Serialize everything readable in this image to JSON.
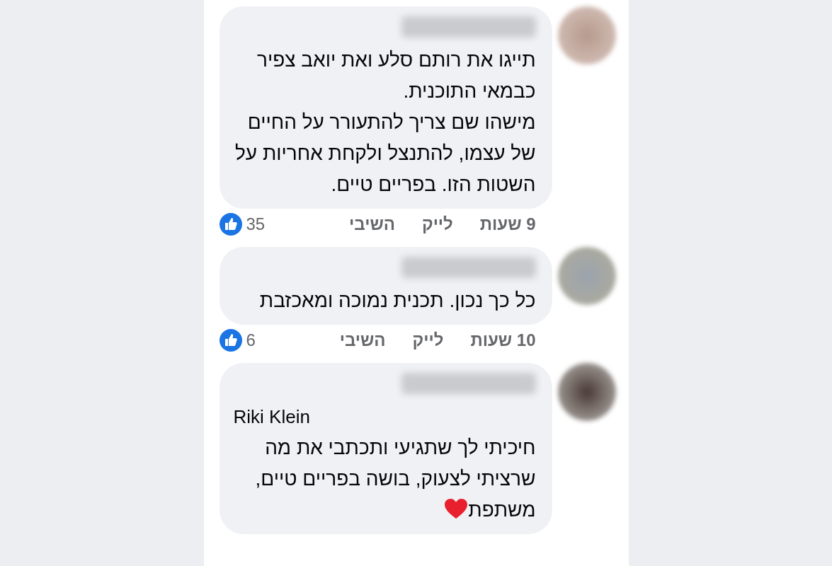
{
  "comments": [
    {
      "paragraphs": [
        "תייגו את רותם סלע ואת יואב צפיר כבמאי התוכנית.",
        "מישהו שם צריך להתעורר על החיים של עצמו, להתנצל ולקחת אחריות על השטות הזו. בפריים טיים."
      ],
      "time": "9 שעות",
      "like": "לייק",
      "reply": "השיבי",
      "reactions": "35"
    },
    {
      "paragraphs": [
        "כל כך נכון. תכנית נמוכה ומאכזבת"
      ],
      "time": "10 שעות",
      "like": "לייק",
      "reply": "השיבי",
      "reactions": "6"
    },
    {
      "mention": "Riki Klein",
      "paragraphs": [
        "חיכיתי לך שתגיעי ותכתבי את מה שרציתי לצעוק,  בושה בפריים טיים,",
        "משתפת"
      ],
      "heart": true
    }
  ]
}
